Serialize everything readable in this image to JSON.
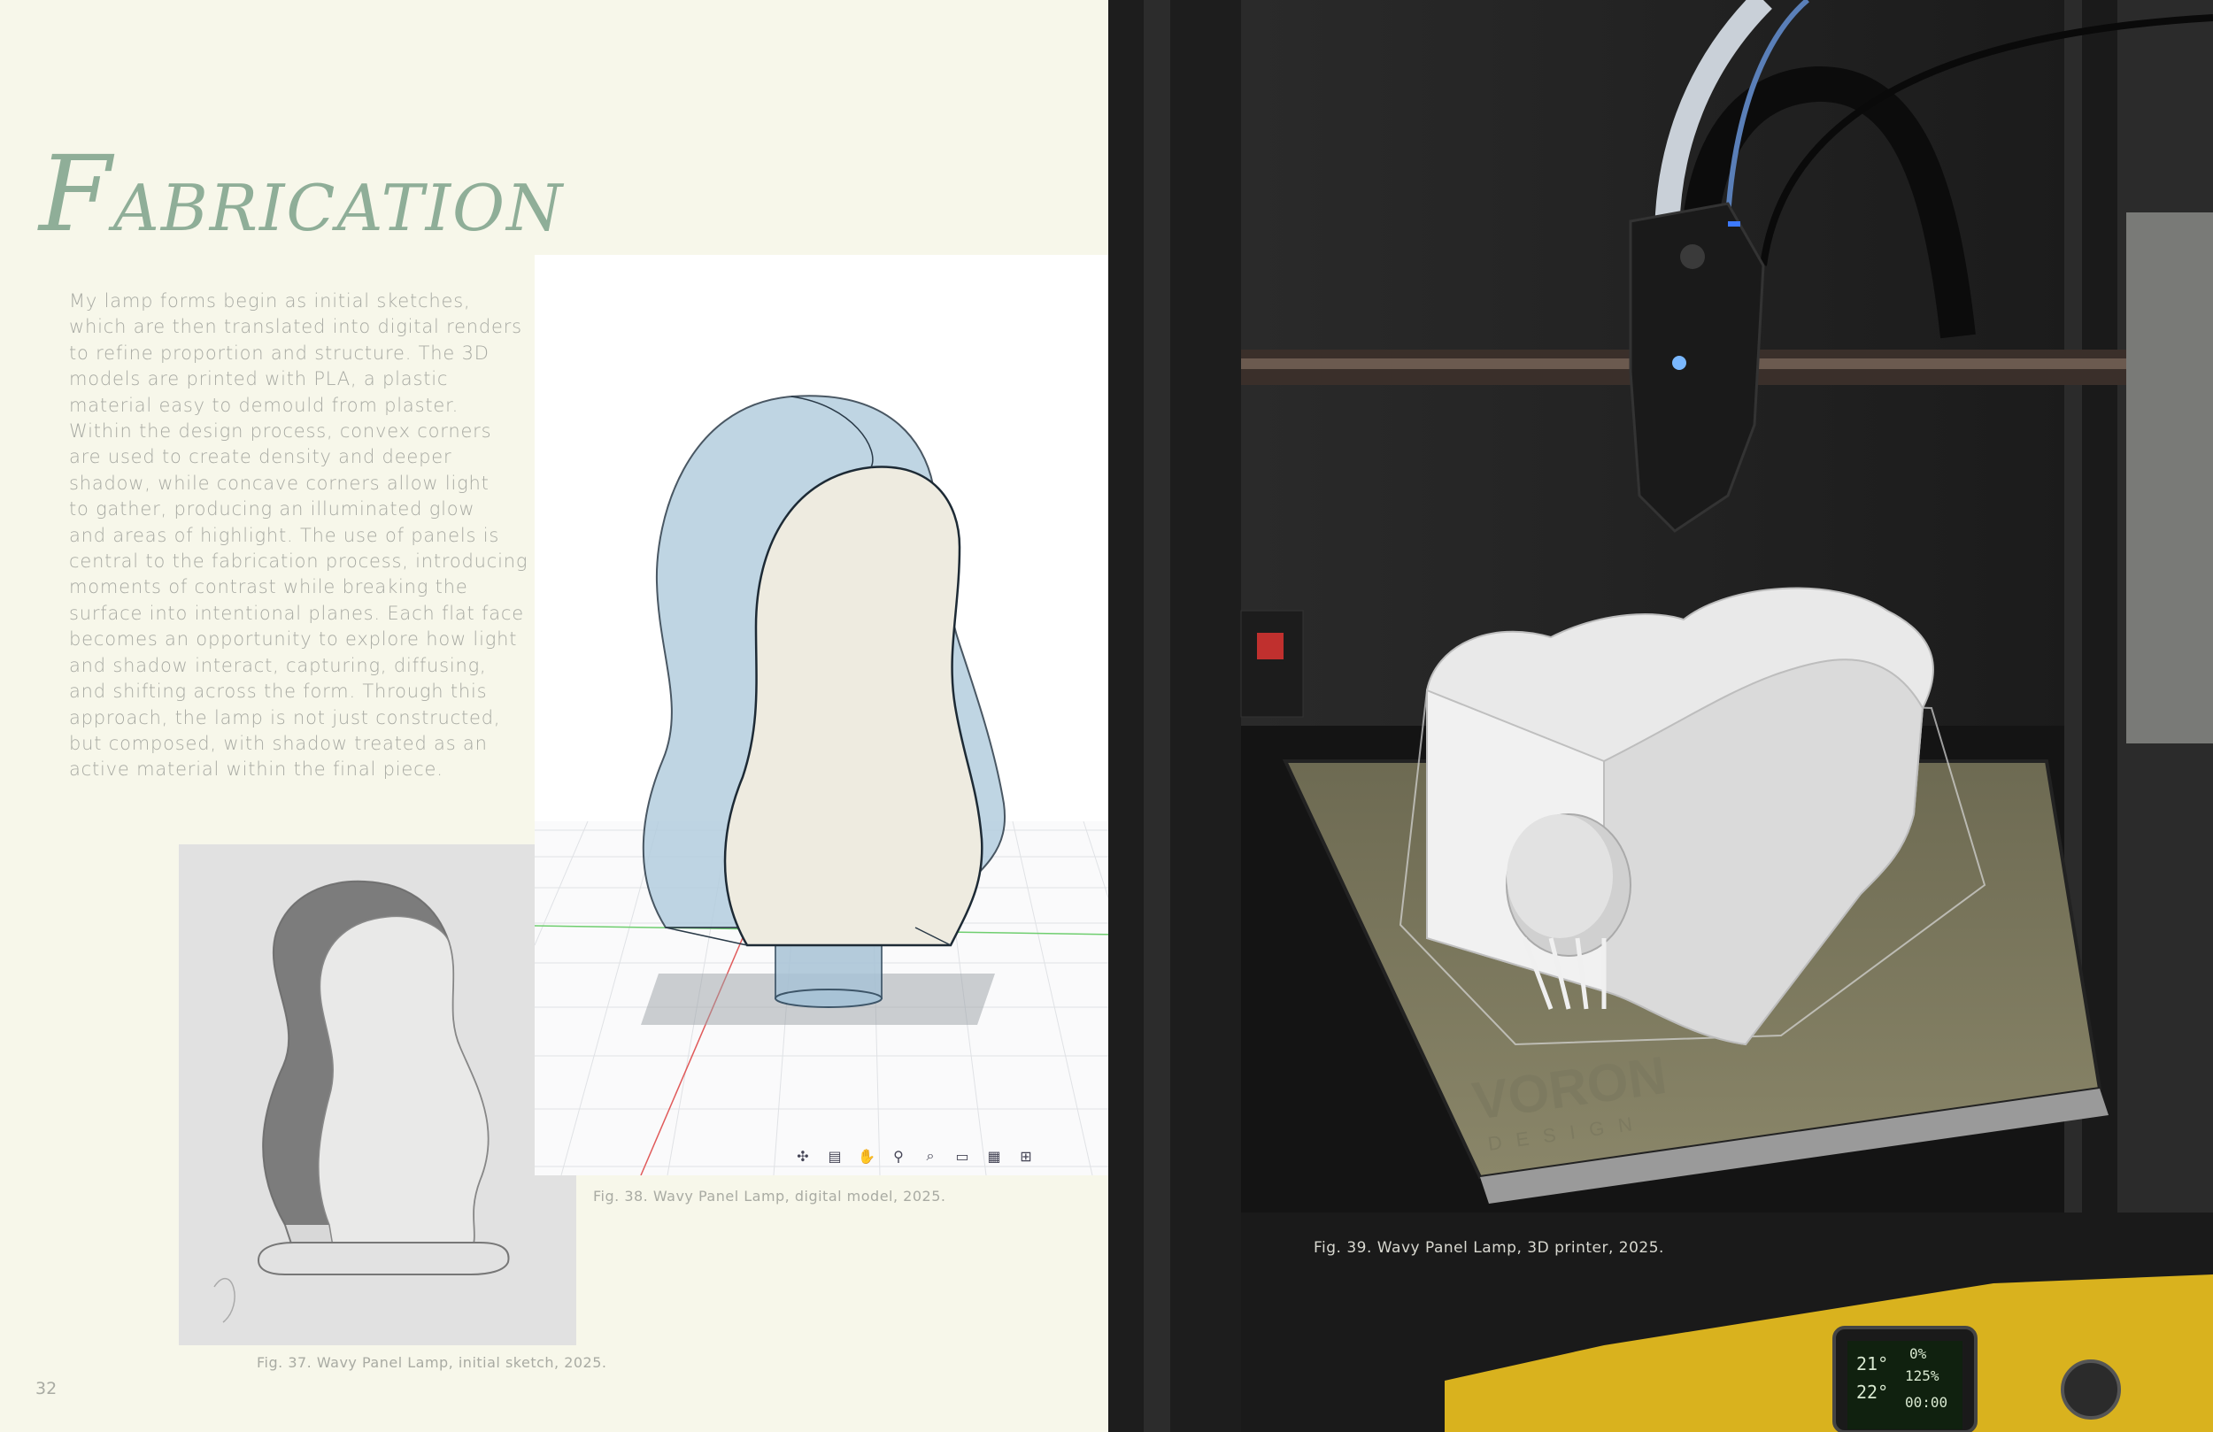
{
  "page": {
    "title_cap": "F",
    "title_rest": "ABRICATION",
    "page_number": "32",
    "body_lines": [
      "My lamp forms begin as initial sketches,",
      "which are then translated into digital renders",
      "to refine proportion and structure. The 3D",
      "models are printed with PLA, a plastic",
      "material easy to demould from plaster.",
      "Within the design process, convex corners",
      "are used to create density and deeper",
      "shadow, while concave corners allow light",
      "to gather, producing an illuminated glow",
      "and areas of highlight. The use of panels is",
      "central to the fabrication process, introducing",
      "moments of contrast while breaking the",
      "surface into intentional planes. Each flat face",
      "becomes an opportunity to explore how light",
      "and shadow interact, capturing, diffusing,",
      "and shifting across the form.  Through this",
      "approach, the lamp is not just constructed,",
      "but composed, with shadow treated as an",
      "active material within the final piece."
    ]
  },
  "figures": {
    "sketch_caption": "Fig. 37. Wavy Panel Lamp, initial sketch, 2025.",
    "model_caption": "Fig. 38. Wavy Panel Lamp, digital model, 2025.",
    "photo_caption": "Fig. 39. Wavy Panel Lamp, 3D printer, 2025."
  },
  "model_toolbar": {
    "icons": [
      "orbit-icon",
      "look-at-icon",
      "pan-icon",
      "zoom-icon",
      "zoom-window-icon",
      "display-settings-icon",
      "grid-icon",
      "viewports-icon"
    ]
  },
  "photo": {
    "bed_logo": "VORON",
    "bed_logo_sub": "DESIGN",
    "display_readouts": [
      "21°",
      "22°",
      "0%",
      "125%",
      "00:00"
    ]
  },
  "colors": {
    "background": "#f7f7ea",
    "title": "#8fae98",
    "body_text": "#a8aaa3"
  }
}
